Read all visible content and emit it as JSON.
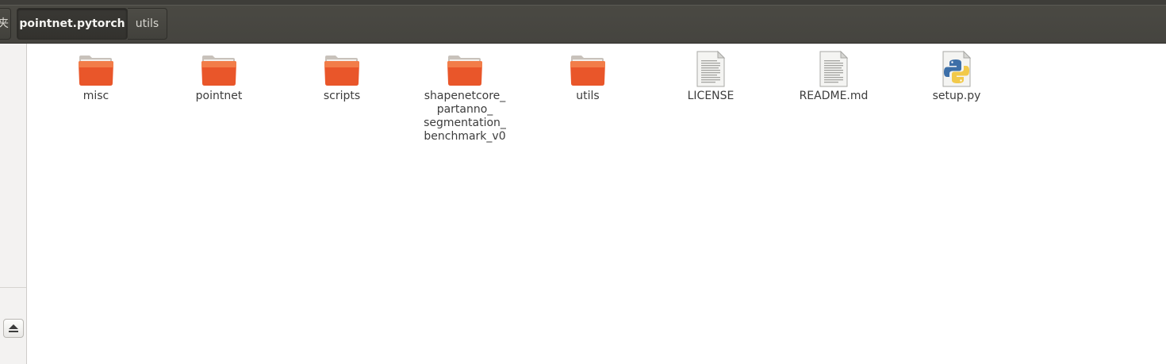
{
  "breadcrumbs": [
    {
      "label": "夹",
      "state": "truncated"
    },
    {
      "label": "pointnet.pytorch",
      "state": "active"
    },
    {
      "label": "utils",
      "state": "normal"
    }
  ],
  "sidebar": {
    "eject_icon": "eject-icon"
  },
  "files": [
    {
      "name": "misc",
      "kind": "folder"
    },
    {
      "name": "pointnet",
      "kind": "folder"
    },
    {
      "name": "scripts",
      "kind": "folder"
    },
    {
      "name_lines": [
        "shapenetcore_",
        "partanno_",
        "segmentation_",
        "benchmark_v0"
      ],
      "kind": "folder"
    },
    {
      "name": "utils",
      "kind": "folder"
    },
    {
      "name": "LICENSE",
      "kind": "text-file"
    },
    {
      "name": "README.md",
      "kind": "text-file"
    },
    {
      "name": "setup.py",
      "kind": "python-file"
    }
  ],
  "colors": {
    "folder_orange": "#e9562a",
    "folder_light": "#f3844f",
    "header_dark": "#3e3d39"
  }
}
